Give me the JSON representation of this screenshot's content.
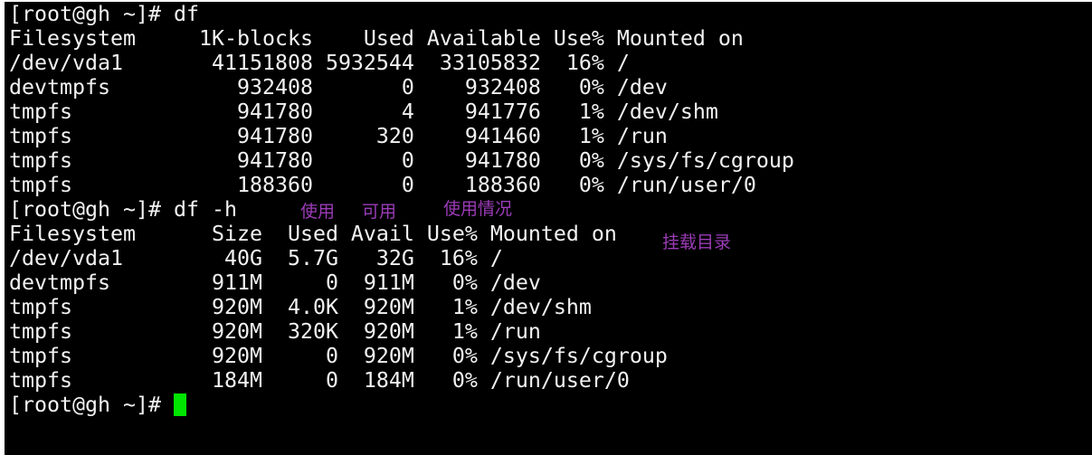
{
  "terminal": {
    "blocks": [
      {
        "command_line": "[root@gh ~]# df",
        "header": "Filesystem     1K-blocks    Used Available Use% Mounted on",
        "rows": [
          "/dev/vda1       41151808 5932544  33105832  16% /",
          "devtmpfs          932408       0    932408   0% /dev",
          "tmpfs             941780       4    941776   1% /dev/shm",
          "tmpfs             941780     320    941460   1% /run",
          "tmpfs             941780       0    941780   0% /sys/fs/cgroup",
          "tmpfs             188360       0    188360   0% /run/user/0"
        ]
      },
      {
        "command_line": "[root@gh ~]# df -h",
        "header": "Filesystem      Size  Used Avail Use% Mounted on",
        "rows": [
          "/dev/vda1        40G  5.7G   32G  16% /",
          "devtmpfs        911M     0  911M   0% /dev",
          "tmpfs           920M  4.0K  920M   1% /dev/shm",
          "tmpfs           920M  320K  920M   1% /run",
          "tmpfs           920M     0  920M   0% /sys/fs/cgroup",
          "tmpfs           184M     0  184M   0% /run/user/0"
        ]
      }
    ],
    "current_prompt": "[root@gh ~]# "
  },
  "annotations": {
    "used": "使用",
    "available": "可用",
    "usage": "使用情况",
    "mount_dir": "挂载目录"
  },
  "colors": {
    "terminal_bg": "#000000",
    "terminal_text": "#f2f2f2",
    "cursor": "#00e600",
    "annotation": "#9c3cb8"
  }
}
